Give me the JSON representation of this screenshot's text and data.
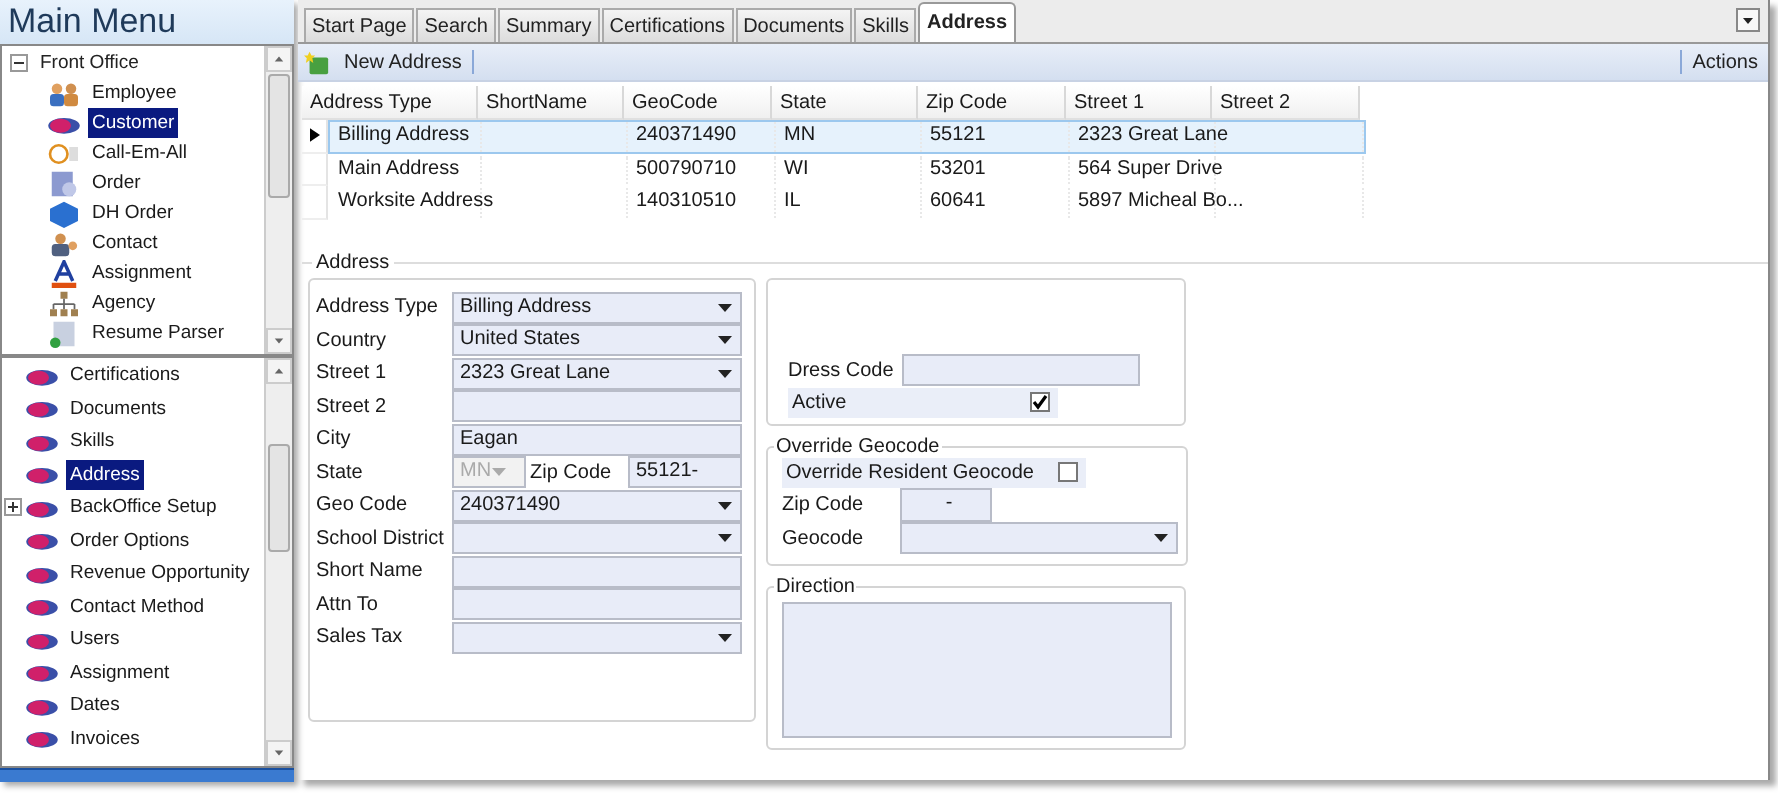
{
  "sidebar": {
    "title": "Main Menu",
    "top_tree": [
      {
        "label": "Front Office",
        "expanded": true,
        "children": [
          {
            "label": "Employee",
            "kind": "people",
            "selected": false
          },
          {
            "label": "Customer",
            "kind": "disc",
            "selected": true
          },
          {
            "label": "Call-Em-All",
            "kind": "phone",
            "selected": false
          },
          {
            "label": "Order",
            "kind": "order",
            "selected": false
          },
          {
            "label": "DH Order",
            "kind": "cube",
            "selected": false
          },
          {
            "label": "Contact",
            "kind": "contact",
            "selected": false
          },
          {
            "label": "Assignment",
            "kind": "letter",
            "selected": false
          },
          {
            "label": "Agency",
            "kind": "org",
            "selected": false
          },
          {
            "label": "Resume Parser",
            "kind": "doc",
            "selected": false
          }
        ]
      }
    ],
    "bottom_tree": [
      {
        "label": "Certifications",
        "selected": false
      },
      {
        "label": "Documents",
        "selected": false
      },
      {
        "label": "Skills",
        "selected": false
      },
      {
        "label": "Address",
        "selected": true
      },
      {
        "label": "BackOffice Setup",
        "selected": false,
        "expanded": false
      },
      {
        "label": "Order Options",
        "selected": false
      },
      {
        "label": "Revenue Opportunity",
        "selected": false
      },
      {
        "label": "Contact Method",
        "selected": false
      },
      {
        "label": "Users",
        "selected": false
      },
      {
        "label": "Assignment",
        "selected": false
      },
      {
        "label": "Dates",
        "selected": false
      },
      {
        "label": "Invoices",
        "selected": false
      }
    ]
  },
  "tabs": [
    {
      "label": "Start Page",
      "selected": false
    },
    {
      "label": "Search",
      "selected": false
    },
    {
      "label": "Summary",
      "selected": false
    },
    {
      "label": "Certifications",
      "selected": false
    },
    {
      "label": "Documents",
      "selected": false
    },
    {
      "label": "Skills",
      "selected": false
    },
    {
      "label": "Address",
      "selected": true
    }
  ],
  "toolbar": {
    "new_button": "New Address",
    "actions": "Actions"
  },
  "grid": {
    "columns": [
      "Address Type",
      "ShortName",
      "GeoCode",
      "State",
      "Zip Code",
      "Street 1",
      "Street 2"
    ],
    "rows": [
      {
        "selected": true,
        "cells": [
          "Billing Address",
          "",
          "240371490",
          "MN",
          "55121",
          "2323 Great Lane",
          ""
        ]
      },
      {
        "selected": false,
        "cells": [
          "Main Address",
          "",
          "500790710",
          "WI",
          "53201",
          "564 Super Drive",
          ""
        ]
      },
      {
        "selected": false,
        "cells": [
          "Worksite Address",
          "",
          "140310510",
          "IL",
          "60641",
          "5897 Micheal Bo...",
          ""
        ]
      }
    ]
  },
  "form": {
    "title": "Address",
    "fields": [
      {
        "label": "Address Type",
        "kind": "select",
        "value": "Billing Address"
      },
      {
        "label": "Country",
        "kind": "select",
        "value": "United States"
      },
      {
        "label": "Street 1",
        "kind": "select",
        "value": "2323 Great Lane"
      },
      {
        "label": "Street 2",
        "kind": "text"
      },
      {
        "label": "City",
        "kind": "text",
        "value": "Eagan"
      },
      {
        "label": "State",
        "kind": "state_zip",
        "value": "MN",
        "disabled": true,
        "zip_label": "Zip Code",
        "zip_value": "55121-"
      },
      {
        "label": "Geo Code",
        "kind": "select",
        "value": "240371490"
      },
      {
        "label": "School District",
        "kind": "select"
      },
      {
        "label": "Short Name",
        "kind": "text"
      },
      {
        "label": "Attn To",
        "kind": "text"
      },
      {
        "label": "Sales Tax",
        "kind": "select"
      }
    ],
    "dress_code_label": "Dress Code",
    "active": {
      "label": "Active",
      "checked": true
    },
    "override": {
      "title": "Override Geocode",
      "checkbox_label": "Override Resident Geocode",
      "checked": false,
      "zip_label": "Zip Code",
      "zip_value": "-",
      "geocode_label": "Geocode"
    },
    "direction": {
      "title": "Direction"
    }
  }
}
